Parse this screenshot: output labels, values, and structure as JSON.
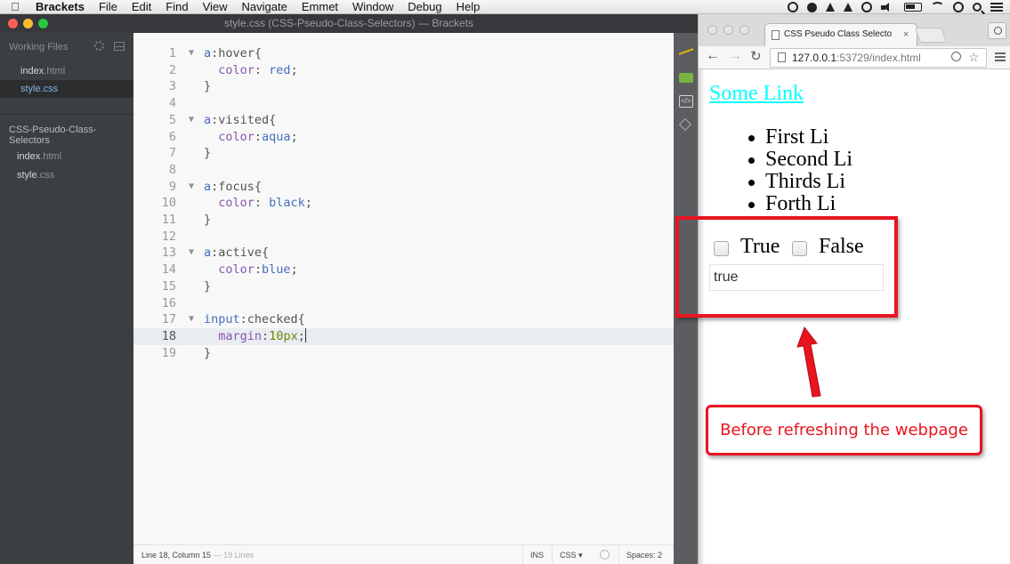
{
  "menubar": {
    "app_name": "Brackets",
    "items": [
      "File",
      "Edit",
      "Find",
      "View",
      "Navigate",
      "Emmet",
      "Window",
      "Debug",
      "Help"
    ]
  },
  "brackets": {
    "window_title": "style.css (CSS-Pseudo-Class-Selectors) — Brackets",
    "sidebar": {
      "working_files_header": "Working Files",
      "working_files": [
        {
          "name": "index",
          "ext": ".html",
          "active": false
        },
        {
          "name": "style",
          "ext": ".css",
          "active": true
        }
      ],
      "project_title": "CSS-Pseudo-Class-Selectors",
      "project_files": [
        {
          "name": "index",
          "ext": ".html"
        },
        {
          "name": "style",
          "ext": ".css"
        }
      ]
    },
    "code_lines": [
      {
        "n": "1",
        "fold": true,
        "parts": [
          [
            "sel",
            "a"
          ],
          [
            "plain",
            ":hover{"
          ]
        ]
      },
      {
        "n": "2",
        "parts": [
          [
            "plain",
            "  "
          ],
          [
            "prop",
            "color"
          ],
          [
            "plain",
            ": "
          ],
          [
            "val",
            "red"
          ],
          [
            "plain",
            ";"
          ]
        ]
      },
      {
        "n": "3",
        "parts": [
          [
            "plain",
            "}"
          ]
        ]
      },
      {
        "n": "4",
        "parts": []
      },
      {
        "n": "5",
        "fold": true,
        "parts": [
          [
            "sel",
            "a"
          ],
          [
            "plain",
            ":visited{"
          ]
        ]
      },
      {
        "n": "6",
        "parts": [
          [
            "plain",
            "  "
          ],
          [
            "prop",
            "color"
          ],
          [
            "plain",
            ":"
          ],
          [
            "val",
            "aqua"
          ],
          [
            "plain",
            ";"
          ]
        ]
      },
      {
        "n": "7",
        "parts": [
          [
            "plain",
            "}"
          ]
        ]
      },
      {
        "n": "8",
        "parts": []
      },
      {
        "n": "9",
        "fold": true,
        "parts": [
          [
            "sel",
            "a"
          ],
          [
            "plain",
            ":focus{"
          ]
        ]
      },
      {
        "n": "10",
        "parts": [
          [
            "plain",
            "  "
          ],
          [
            "prop",
            "color"
          ],
          [
            "plain",
            ": "
          ],
          [
            "val",
            "black"
          ],
          [
            "plain",
            ";"
          ]
        ]
      },
      {
        "n": "11",
        "parts": [
          [
            "plain",
            "}"
          ]
        ]
      },
      {
        "n": "12",
        "parts": []
      },
      {
        "n": "13",
        "fold": true,
        "parts": [
          [
            "sel",
            "a"
          ],
          [
            "plain",
            ":active{"
          ]
        ]
      },
      {
        "n": "14",
        "parts": [
          [
            "plain",
            "  "
          ],
          [
            "prop",
            "color"
          ],
          [
            "plain",
            ":"
          ],
          [
            "val",
            "blue"
          ],
          [
            "plain",
            ";"
          ]
        ]
      },
      {
        "n": "15",
        "parts": [
          [
            "plain",
            "}"
          ]
        ]
      },
      {
        "n": "16",
        "parts": []
      },
      {
        "n": "17",
        "fold": true,
        "parts": [
          [
            "sel",
            "input"
          ],
          [
            "plain",
            ":checked{"
          ]
        ]
      },
      {
        "n": "18",
        "current": true,
        "parts": [
          [
            "plain",
            "  "
          ],
          [
            "prop",
            "margin"
          ],
          [
            "plain",
            ":"
          ],
          [
            "num",
            "10px"
          ],
          [
            "plain",
            ";"
          ]
        ]
      },
      {
        "n": "19",
        "parts": [
          [
            "plain",
            "}"
          ]
        ]
      }
    ],
    "statusbar": {
      "position": "Line 18, Column 15",
      "lines": "— 19 Lines",
      "mode": "INS",
      "language": "CSS",
      "spaces": "Spaces: 2"
    }
  },
  "chrome": {
    "tab_title": "CSS Pseudo Class Selecto",
    "url_host": "127.0.0.1",
    "url_rest": ":53729/index.html",
    "page": {
      "link_text": "Some Link",
      "link_color": "#00ffff",
      "list_items": [
        "First Li",
        "Second Li",
        "Thirds Li",
        "Forth Li"
      ],
      "checkbox_true_label": "True",
      "checkbox_false_label": "False",
      "text_input_value": "true"
    }
  },
  "annotation": {
    "callout_text": "Before refreshing the webpage",
    "color": "#e8141f"
  },
  "colors": {
    "selector": "#446fbd",
    "property": "#8757ad",
    "number": "#6d8600",
    "active_file": "#82b4e8"
  }
}
